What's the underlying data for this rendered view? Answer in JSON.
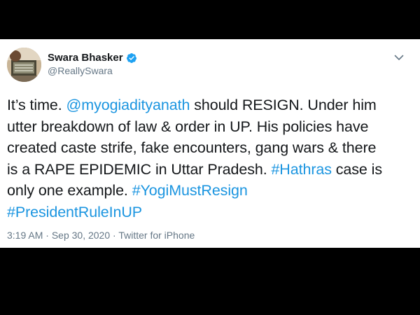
{
  "colors": {
    "background": "#000000",
    "card": "#ffffff",
    "text": "#14171a",
    "secondary": "#657786",
    "link": "#1b95e0",
    "verified": "#1da1f2"
  },
  "author": {
    "name": "Swara Bhasker",
    "handle": "@ReallySwara",
    "verified_icon": "verified-badge-icon",
    "menu_icon": "chevron-down-icon"
  },
  "tweet": {
    "line1": {
      "t1": "It’s time. ",
      "mention": "@myogiadityanath",
      "t2": " should RESIGN. Under him"
    },
    "line2": "utter breakdown of law & order in UP. His policies have",
    "line3": "created caste strife, fake encounters, gang wars & there",
    "line4": {
      "t1": "is a RAPE EPIDEMIC in Uttar Pradesh. ",
      "hashtag": "#Hathras",
      "t2": " case is"
    },
    "line5": {
      "t1": "only one example. ",
      "hashtag": "#YogiMustResign"
    },
    "line6": {
      "hashtag": "#PresidentRuleInUP"
    }
  },
  "meta": {
    "time": "3:19 AM",
    "sep1": " · ",
    "date": "Sep 30, 2020",
    "sep2": " · ",
    "source": "Twitter for iPhone"
  }
}
